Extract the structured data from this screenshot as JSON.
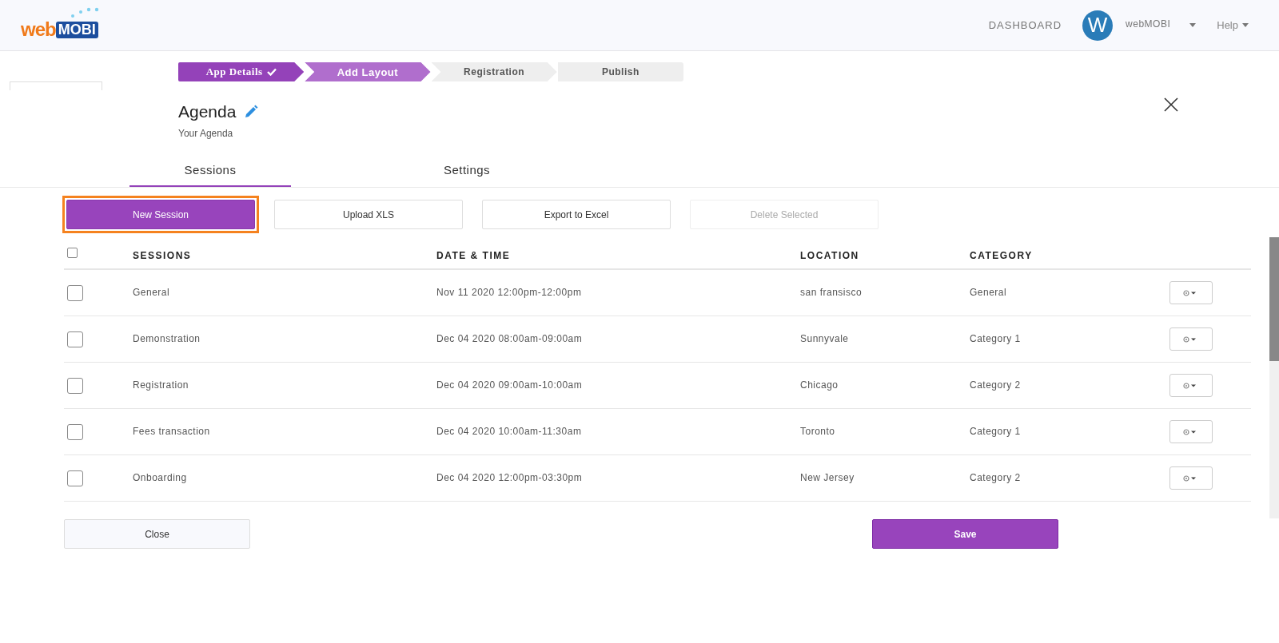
{
  "header": {
    "logo": {
      "part1": "web",
      "part2": "MOBI"
    },
    "nav": [
      "DASHBOARD"
    ],
    "user": {
      "initial": "W",
      "name": "webMOBI"
    },
    "help": "Help"
  },
  "stepper": [
    {
      "label": "App Details",
      "completed": true,
      "selected": false
    },
    {
      "label": "Add Layout",
      "completed": false,
      "selected": true
    },
    {
      "label": "Registration",
      "completed": false,
      "selected": false
    },
    {
      "label": "Publish",
      "completed": false,
      "selected": false
    }
  ],
  "module": {
    "title": "Agenda",
    "subtitle": "Your Agenda"
  },
  "tabs": [
    {
      "label": "Sessions",
      "selected": true
    },
    {
      "label": "Settings",
      "selected": false
    }
  ],
  "toolbar": [
    {
      "label": "New Session",
      "kind": "primary",
      "highlighted": true,
      "disabled": false
    },
    {
      "label": "Upload XLS",
      "kind": "default",
      "highlighted": false,
      "disabled": false
    },
    {
      "label": "Export to Excel",
      "kind": "default",
      "highlighted": false,
      "disabled": false
    },
    {
      "label": "Delete Selected",
      "kind": "default",
      "highlighted": false,
      "disabled": true
    }
  ],
  "table": {
    "select_all_checked": false,
    "columns": [
      "SESSIONS",
      "DATE & TIME",
      "LOCATION",
      "CATEGORY"
    ],
    "rows": [
      {
        "checked": false,
        "cells": [
          "General",
          "Nov 11 2020 12:00pm-12:00pm",
          "san fransisco",
          "General"
        ]
      },
      {
        "checked": false,
        "cells": [
          "Demonstration",
          "Dec 04 2020 08:00am-09:00am",
          "Sunnyvale",
          "Category 1"
        ]
      },
      {
        "checked": false,
        "cells": [
          "Registration",
          "Dec 04 2020 09:00am-10:00am",
          "Chicago",
          "Category 2"
        ]
      },
      {
        "checked": false,
        "cells": [
          "Fees transaction",
          "Dec 04 2020 10:00am-11:30am",
          "Toronto",
          "Category 1"
        ]
      },
      {
        "checked": false,
        "cells": [
          "Onboarding",
          "Dec 04 2020 12:00pm-03:30pm",
          "New Jersey",
          "Category 2"
        ]
      }
    ]
  },
  "footer": {
    "close": "Close",
    "save": "Save"
  }
}
